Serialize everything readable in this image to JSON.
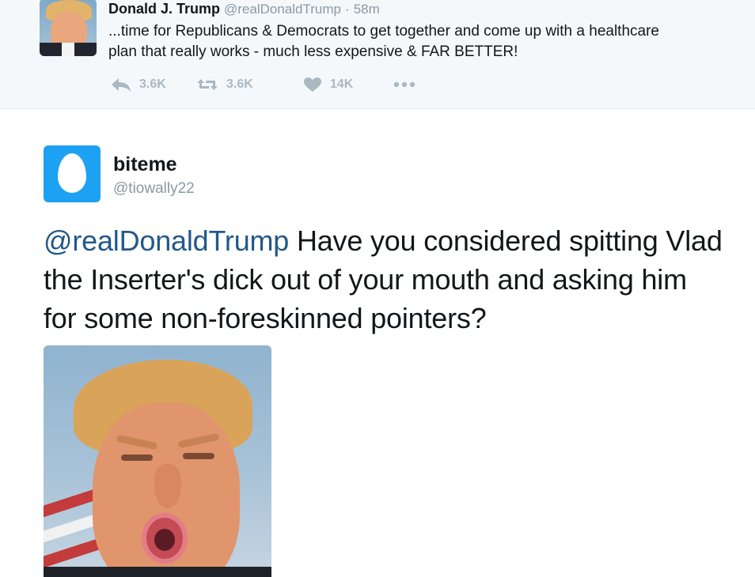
{
  "parent_tweet": {
    "author_name": "Donald J. Trump",
    "author_handle": "@realDonaldTrump",
    "separator": "·",
    "timestamp": "58m",
    "text": "...time for Republicans & Democrats to get together and come up with a healthcare plan that really works - much less expensive & FAR BETTER!",
    "actions": {
      "reply_count": "3.6K",
      "retweet_count": "3.6K",
      "like_count": "14K",
      "reply_icon": "reply-icon",
      "retweet_icon": "retweet-icon",
      "like_icon": "heart-icon",
      "more_icon": "more-dots-icon"
    }
  },
  "reply_tweet": {
    "author_name": "biteme",
    "author_handle": "@tiowally22",
    "mention": "@realDonaldTrump",
    "text": " Have you considered spitting Vlad the Inserter's dick out of your mouth and asking him for some non-foreskinned pointers?"
  },
  "colors": {
    "accent_blue": "#1da1f2",
    "mention": "#22588a",
    "muted": "#8899a6",
    "icon_gray": "#aab8c2",
    "parent_bg": "#f5f8fa"
  }
}
